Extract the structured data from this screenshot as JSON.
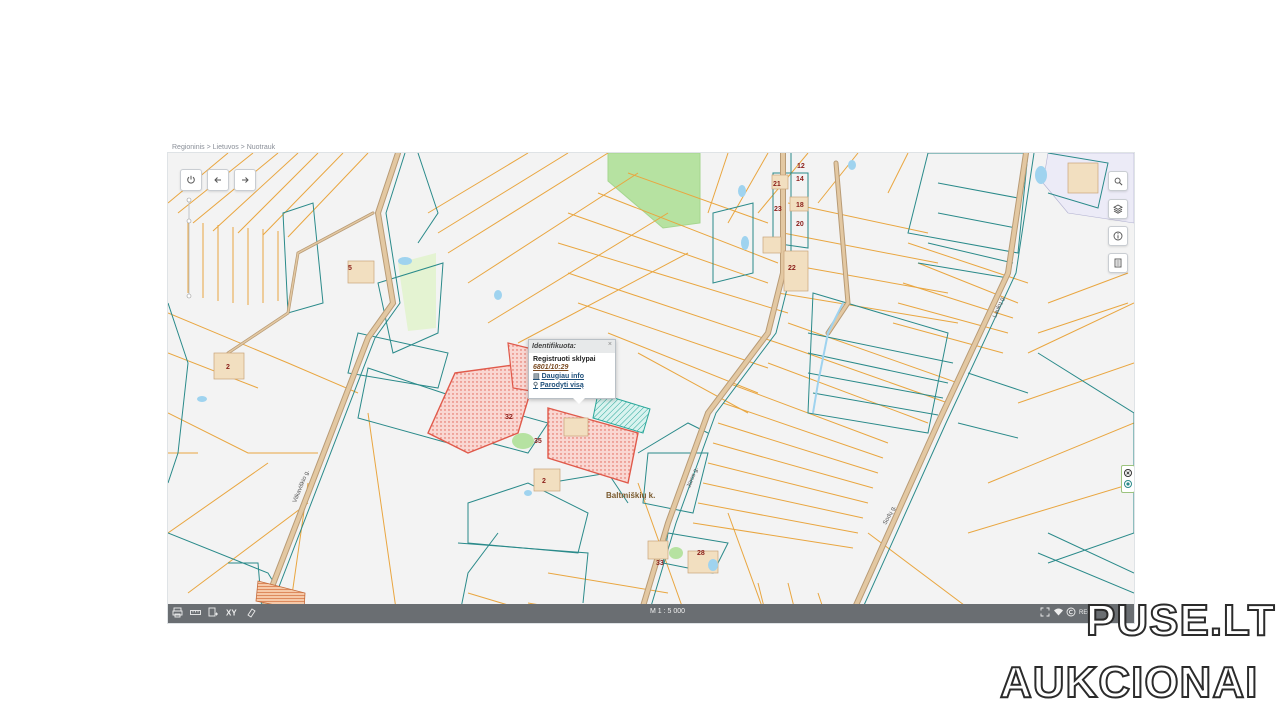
{
  "breadcrumb": "Regioninis > Lietuvos > Nuotrauk",
  "map": {
    "parcel_numbers": [
      "12",
      "14",
      "21",
      "18",
      "23",
      "20",
      "22",
      "5",
      "2",
      "32",
      "35",
      "28",
      "33",
      "2"
    ],
    "place_label": "Baltmiškių k.",
    "road_labels": [
      "Vilkaviškio g.",
      "Jūros g.",
      "Laukų g.",
      "Sodų g."
    ],
    "colors": {
      "background": "#f3f3f3",
      "parcel_line_orange": "#e9a640",
      "parcel_line_teal": "#2a8a8a",
      "road_fill": "#e3c8a2",
      "road_edge": "#b89b76",
      "forest": "#b6e2a1",
      "selected_fill": "#f4b6b0",
      "selected_edge": "#e05a4b",
      "water": "#9fd3ef",
      "building": "#f2dfc0"
    }
  },
  "controls": {
    "top_left": [
      "power-icon",
      "arrow-left-icon",
      "arrow-right-icon"
    ],
    "right": [
      "search-icon",
      "layers-icon",
      "info-icon",
      "document-icon"
    ]
  },
  "popup": {
    "header": "Identifikuota:",
    "close": "×",
    "title": "Registruoti sklypai",
    "cadastral_number": "6801/10:29",
    "more_info": "Daugiau info",
    "show_all": "Parodyti visą"
  },
  "bottom_bar": {
    "scale": "M 1 : 5 000",
    "right_text": "REG",
    "left_tools": [
      "print-icon",
      "ruler-icon",
      "draw-icon",
      "xy-icon",
      "eraser-icon"
    ],
    "right_tools": [
      "fullscreen-icon",
      "wifi-icon",
      "copyright-icon"
    ]
  },
  "watermark": {
    "line1": "PUSE.LT",
    "line2": "AUKCIONAI"
  }
}
